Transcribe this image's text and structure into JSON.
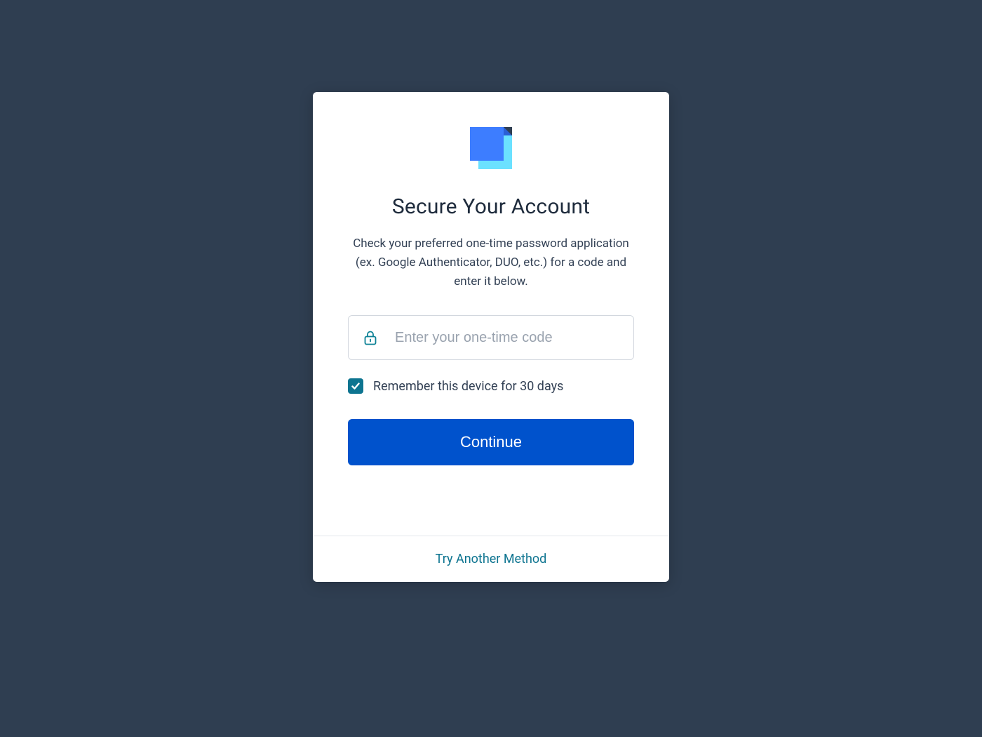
{
  "logo": {
    "name": "app-logo"
  },
  "title": "Secure Your Account",
  "subtitle": "Check your preferred one-time password application (ex. Google Authenticator, DUO, etc.) for a code and enter it below.",
  "codeInput": {
    "placeholder": "Enter your one-time code",
    "value": ""
  },
  "remember": {
    "checked": true,
    "label": "Remember this device for 30 days"
  },
  "continueLabel": "Continue",
  "footerLink": "Try Another Method",
  "colors": {
    "pageBg": "#2f3e51",
    "primaryButton": "#0052cc",
    "accent": "#0d7490"
  }
}
